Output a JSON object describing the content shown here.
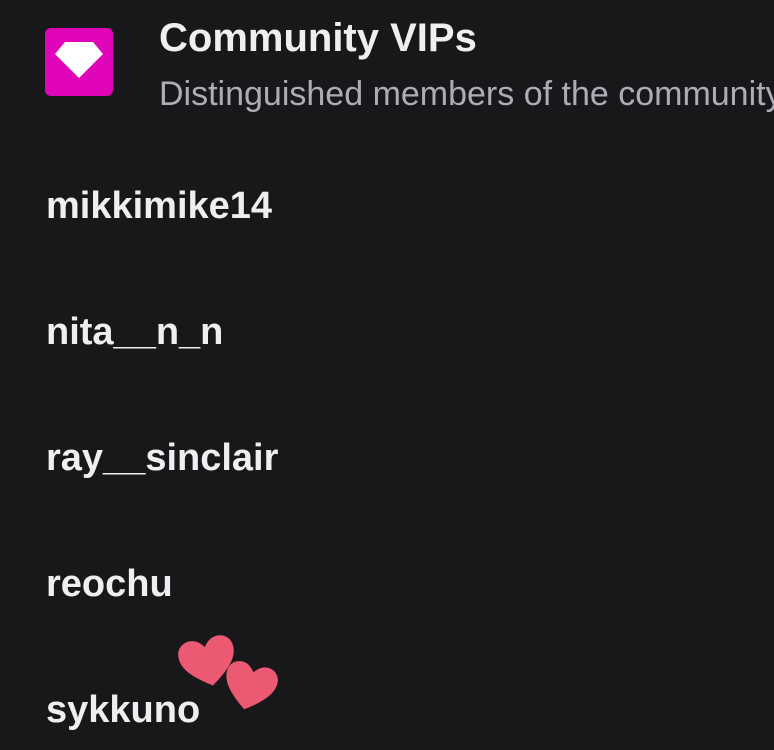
{
  "section": {
    "title": "Community VIPs",
    "subtitle": "Distinguished members of the community",
    "badge_color": "#e005b9",
    "badge_icon": "diamond-icon"
  },
  "vips": [
    {
      "username": "mikkimike14"
    },
    {
      "username": "nita__n_n"
    },
    {
      "username": "ray__sinclair"
    },
    {
      "username": "reochu"
    },
    {
      "username": "sykkuno",
      "decoration": "hearts-icon"
    }
  ],
  "colors": {
    "background": "#18181b",
    "text": "#efeff1",
    "muted_text": "#adadb8",
    "heart": "#eb5a72"
  }
}
